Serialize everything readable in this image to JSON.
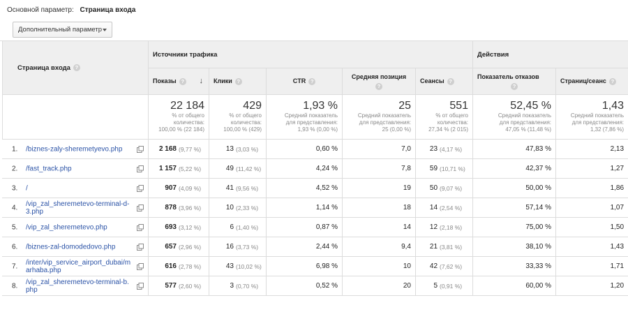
{
  "primary_dimension": {
    "label": "Основной параметр:",
    "value": "Страница входа"
  },
  "secondary_dimension": {
    "label": "Дополнительный параметр"
  },
  "groups": {
    "traffic": "Источники трафика",
    "actions": "Действия"
  },
  "columns": {
    "landing_page": "Страница входа",
    "impressions": "Показы",
    "clicks": "Клики",
    "ctr": "CTR",
    "avg_position": "Средняя позиция",
    "sessions": "Сеансы",
    "bounce_rate": "Показатель отказов",
    "pages_session": "Страниц/сеанс"
  },
  "help_glyph": "?",
  "sort_glyph": "↓",
  "totals": {
    "impressions": {
      "big": "22 184",
      "sub": [
        "% от общего",
        "количества:",
        "100,00 % (22 184)"
      ]
    },
    "clicks": {
      "big": "429",
      "sub": [
        "% от общего",
        "количества:",
        "100,00 % (429)"
      ]
    },
    "ctr": {
      "big": "1,93 %",
      "sub": [
        "Средний показатель",
        "для представления:",
        "1,93 % (0,00 %)"
      ]
    },
    "avg_position": {
      "big": "25",
      "sub": [
        "Средний показатель",
        "для представления:",
        "25 (0,00 %)"
      ]
    },
    "sessions": {
      "big": "551",
      "sub": [
        "% от общего",
        "количества:",
        "27,34 % (2 015)"
      ]
    },
    "bounce_rate": {
      "big": "52,45 %",
      "sub": [
        "Средний показатель",
        "для представления:",
        "47,05 % (11,48 %)"
      ]
    },
    "pages_session": {
      "big": "1,43",
      "sub": [
        "Средний показатель",
        "для представления:",
        "1,32 (7,86 %)"
      ]
    }
  },
  "rows": [
    {
      "n": "1.",
      "page": "/biznes-zaly-sheremetyevo.php",
      "impressions": "2 168",
      "impressions_pct": "(9,77 %)",
      "clicks": "13",
      "clicks_pct": "(3,03 %)",
      "ctr": "0,60 %",
      "avg_position": "7,0",
      "sessions": "23",
      "sessions_pct": "(4,17 %)",
      "bounce_rate": "47,83 %",
      "pages_session": "2,13"
    },
    {
      "n": "2.",
      "page": "/fast_track.php",
      "impressions": "1 157",
      "impressions_pct": "(5,22 %)",
      "clicks": "49",
      "clicks_pct": "(11,42 %)",
      "ctr": "4,24 %",
      "avg_position": "7,8",
      "sessions": "59",
      "sessions_pct": "(10,71 %)",
      "bounce_rate": "42,37 %",
      "pages_session": "1,27"
    },
    {
      "n": "3.",
      "page": "/",
      "impressions": "907",
      "impressions_pct": "(4,09 %)",
      "clicks": "41",
      "clicks_pct": "(9,56 %)",
      "ctr": "4,52 %",
      "avg_position": "19",
      "sessions": "50",
      "sessions_pct": "(9,07 %)",
      "bounce_rate": "50,00 %",
      "pages_session": "1,86"
    },
    {
      "n": "4.",
      "page": "/vip_zal_sheremetevo-terminal-d-3.php",
      "impressions": "878",
      "impressions_pct": "(3,96 %)",
      "clicks": "10",
      "clicks_pct": "(2,33 %)",
      "ctr": "1,14 %",
      "avg_position": "18",
      "sessions": "14",
      "sessions_pct": "(2,54 %)",
      "bounce_rate": "57,14 %",
      "pages_session": "1,07"
    },
    {
      "n": "5.",
      "page": "/vip_zal_sheremetevo.php",
      "impressions": "693",
      "impressions_pct": "(3,12 %)",
      "clicks": "6",
      "clicks_pct": "(1,40 %)",
      "ctr": "0,87 %",
      "avg_position": "14",
      "sessions": "12",
      "sessions_pct": "(2,18 %)",
      "bounce_rate": "75,00 %",
      "pages_session": "1,50"
    },
    {
      "n": "6.",
      "page": "/biznes-zal-domodedovo.php",
      "impressions": "657",
      "impressions_pct": "(2,96 %)",
      "clicks": "16",
      "clicks_pct": "(3,73 %)",
      "ctr": "2,44 %",
      "avg_position": "9,4",
      "sessions": "21",
      "sessions_pct": "(3,81 %)",
      "bounce_rate": "38,10 %",
      "pages_session": "1,43"
    },
    {
      "n": "7.",
      "page": "/inter/vip_service_airport_dubai/marhaba.php",
      "impressions": "616",
      "impressions_pct": "(2,78 %)",
      "clicks": "43",
      "clicks_pct": "(10,02 %)",
      "ctr": "6,98 %",
      "avg_position": "10",
      "sessions": "42",
      "sessions_pct": "(7,62 %)",
      "bounce_rate": "33,33 %",
      "pages_session": "1,71"
    },
    {
      "n": "8.",
      "page": "/vip_zal_sheremetevo-terminal-b.php",
      "impressions": "577",
      "impressions_pct": "(2,60 %)",
      "clicks": "3",
      "clicks_pct": "(0,70 %)",
      "ctr": "0,52 %",
      "avg_position": "20",
      "sessions": "5",
      "sessions_pct": "(0,91 %)",
      "bounce_rate": "60,00 %",
      "pages_session": "1,20"
    }
  ],
  "colors": {
    "link": "#2a52a6",
    "header_bg": "#efefef",
    "border": "#dcdcdc"
  }
}
